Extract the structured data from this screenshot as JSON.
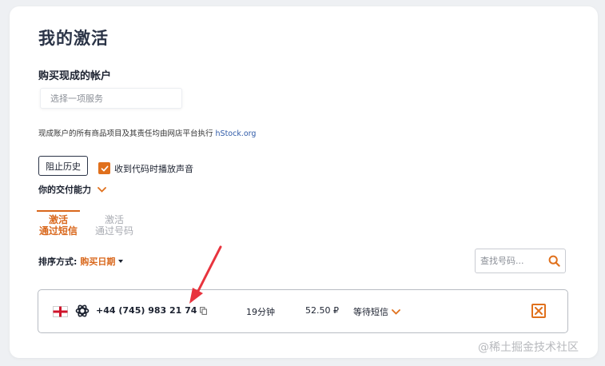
{
  "page": {
    "title": "我的激活",
    "subtitle": "购买现成的帐户",
    "service_placeholder": "选择一项服务",
    "disclaimer_text": "现成账户的所有商品项目及其责任均由网店平台执行 ",
    "disclaimer_link": "hStock.org",
    "history_button": "阻止历史",
    "sound_checkbox_label": "收到代码时播放声音",
    "sound_checkbox_checked": true,
    "capacity_label": "你的交付能力"
  },
  "tabs": [
    {
      "line1": "激活",
      "line2": "通过短信",
      "active": true
    },
    {
      "line1": "激活",
      "line2": "通过号码",
      "active": false
    }
  ],
  "sort": {
    "label": "排序方式:",
    "value": "购买日期"
  },
  "search": {
    "placeholder": "查找号码..."
  },
  "activation": {
    "country_flag": "uk-flag-icon",
    "service_icon": "openai-icon",
    "phone": "+44 (745) 983 21 74",
    "duration": "19分钟",
    "price": "52.50 ₽",
    "status": "等待短信"
  },
  "watermark": "@稀土掘金技术社区",
  "colors": {
    "accent": "#e0701c",
    "title": "#2b3447",
    "link": "#2f5aa8",
    "annotation_arrow": "#e8343e"
  }
}
